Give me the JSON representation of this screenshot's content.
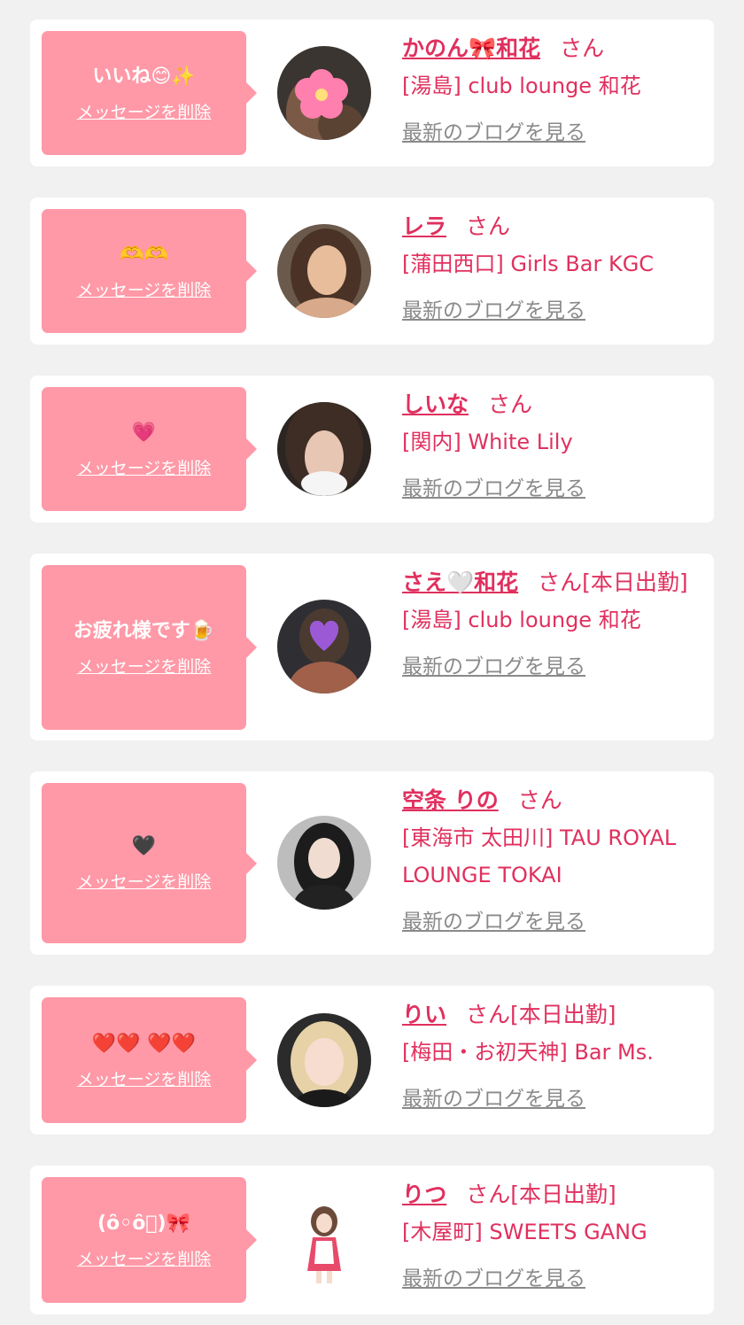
{
  "cards": [
    {
      "message": "いいね😊✨",
      "delete_label": "メッセージを削除",
      "name": "かのん🎀和花",
      "honorific": "さん",
      "status": "",
      "shop": "[湯島] club lounge 和花",
      "blog_label": "最新のブログを見る",
      "avatar_icon": "avatar-photo-cherry-blossom-icon"
    },
    {
      "message": "🫶🫶",
      "delete_label": "メッセージを削除",
      "name": "レラ",
      "honorific": "さん",
      "status": "",
      "shop": "[蒲田西口] Girls Bar KGC",
      "blog_label": "最新のブログを見る",
      "avatar_icon": "avatar-photo-icon"
    },
    {
      "message": "💗",
      "delete_label": "メッセージを削除",
      "name": "しいな",
      "honorific": "さん",
      "status": "",
      "shop": "[関内] White Lily",
      "blog_label": "最新のブログを見る",
      "avatar_icon": "avatar-photo-icon"
    },
    {
      "message": "お疲れ様です🍺",
      "delete_label": "メッセージを削除",
      "name": "さえ🤍和花",
      "honorific": "さん",
      "status": "[本日出勤]",
      "shop": "[湯島] club lounge 和花",
      "blog_label": "最新のブログを見る",
      "avatar_icon": "avatar-photo-purple-heart-icon"
    },
    {
      "message": "🖤",
      "delete_label": "メッセージを削除",
      "name": "空条 りの",
      "honorific": "さん",
      "status": "",
      "shop": "[東海市 太田川] TAU ROYAL LOUNGE TOKAI",
      "blog_label": "最新のブログを見る",
      "avatar_icon": "avatar-photo-icon"
    },
    {
      "message": "❤️❤️ ❤️❤️",
      "delete_label": "メッセージを削除",
      "name": "りい",
      "honorific": "さん",
      "status": "[本日出勤]",
      "shop": "[梅田・お初天神] Bar Ms.",
      "blog_label": "最新のブログを見る",
      "avatar_icon": "avatar-photo-icon"
    },
    {
      "message": "(ȏ◦ȏ⃝)🎀",
      "delete_label": "メッセージを削除",
      "name": "りつ",
      "honorific": "さん",
      "status": "[本日出勤]",
      "shop": "[木屋町] SWEETS GANG",
      "blog_label": "最新のブログを見る",
      "avatar_icon": "avatar-photo-icon"
    }
  ]
}
